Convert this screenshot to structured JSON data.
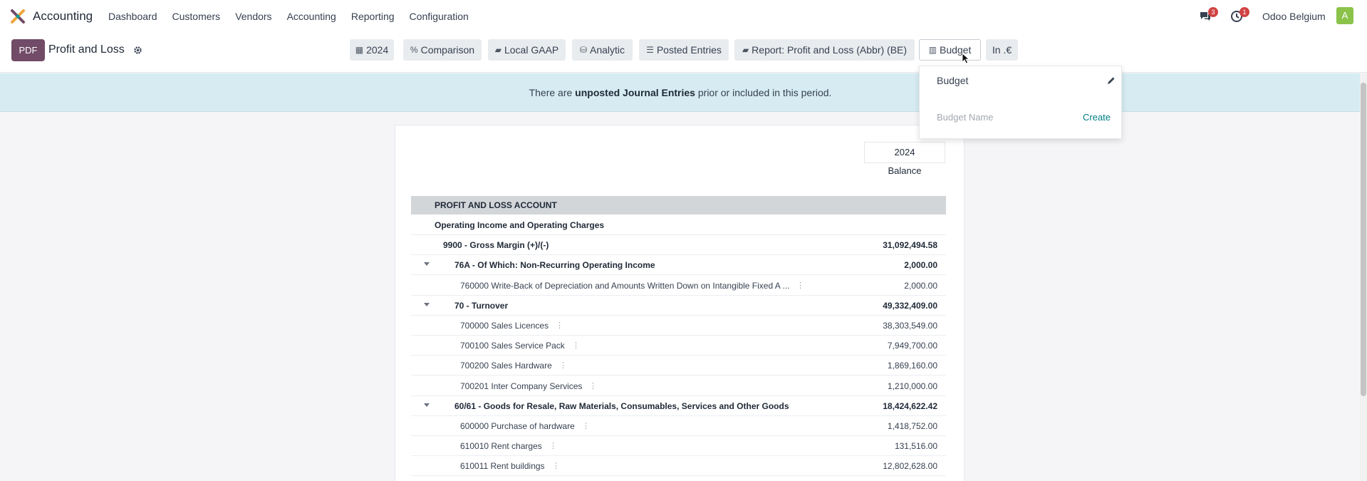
{
  "navbar": {
    "app_name": "Accounting",
    "menu": [
      "Dashboard",
      "Customers",
      "Vendors",
      "Accounting",
      "Reporting",
      "Configuration"
    ],
    "chat_badge": "3",
    "activity_badge": "1",
    "company": "Odoo Belgium",
    "avatar_letter": "A"
  },
  "control": {
    "pdf_label": "PDF",
    "title": "Profit and Loss",
    "filters": [
      {
        "label": "2024",
        "icon": "calendar-icon"
      },
      {
        "label": "Comparison",
        "icon": "percent-icon"
      },
      {
        "label": "Local GAAP",
        "icon": "book-icon"
      },
      {
        "label": "Analytic",
        "icon": "database-icon"
      },
      {
        "label": "Posted Entries",
        "icon": "sliders-icon"
      },
      {
        "label": "Report: Profit and Loss (Abbr) (BE)",
        "icon": "book-icon"
      },
      {
        "label": "Budget",
        "icon": "bar-chart-icon"
      },
      {
        "label": "In .€",
        "icon": ""
      }
    ]
  },
  "banner": {
    "pre": "There are ",
    "strong": "unposted Journal Entries",
    "post": " prior or included in this period."
  },
  "report": {
    "column_period": "2024",
    "column_label": "Balance",
    "section": "PROFIT AND LOSS ACCOUNT",
    "rows": [
      {
        "label": "Operating Income and Operating Charges",
        "value": "",
        "level": 0,
        "bold": true,
        "caret": false,
        "dots": false
      },
      {
        "label": "9900 - Gross Margin (+)/(-)",
        "value": "31,092,494.58",
        "level": 1,
        "bold": true,
        "caret": false,
        "dots": false
      },
      {
        "label": "76A - Of Which: Non-Recurring Operating Income",
        "value": "2,000.00",
        "level": 2,
        "bold": true,
        "caret": true,
        "dots": false
      },
      {
        "label": "760000 Write-Back of Depreciation and Amounts Written Down on Intangible Fixed A ...",
        "value": "2,000.00",
        "level": 3,
        "bold": false,
        "caret": false,
        "dots": true
      },
      {
        "label": "70 - Turnover",
        "value": "49,332,409.00",
        "level": 2,
        "bold": true,
        "caret": true,
        "dots": false
      },
      {
        "label": "700000 Sales Licences",
        "value": "38,303,549.00",
        "level": 3,
        "bold": false,
        "caret": false,
        "dots": true
      },
      {
        "label": "700100 Sales Service Pack",
        "value": "7,949,700.00",
        "level": 3,
        "bold": false,
        "caret": false,
        "dots": true
      },
      {
        "label": "700200 Sales Hardware",
        "value": "1,869,160.00",
        "level": 3,
        "bold": false,
        "caret": false,
        "dots": true
      },
      {
        "label": "700201 Inter Company Services",
        "value": "1,210,000.00",
        "level": 3,
        "bold": false,
        "caret": false,
        "dots": true
      },
      {
        "label": "60/61 - Goods for Resale, Raw Materials, Consumables, Services and Other Goods",
        "value": "18,424,622.42",
        "level": 2,
        "bold": true,
        "caret": true,
        "dots": false
      },
      {
        "label": "600000 Purchase of hardware",
        "value": "1,418,752.00",
        "level": 3,
        "bold": false,
        "caret": false,
        "dots": true
      },
      {
        "label": "610010 Rent charges",
        "value": "131,516.00",
        "level": 3,
        "bold": false,
        "caret": false,
        "dots": true
      },
      {
        "label": "610011 Rent buildings",
        "value": "12,802,628.00",
        "level": 3,
        "bold": false,
        "caret": false,
        "dots": true
      }
    ]
  },
  "budget_dropdown": {
    "item_label": "Budget",
    "input_placeholder": "Budget Name",
    "create_label": "Create"
  }
}
